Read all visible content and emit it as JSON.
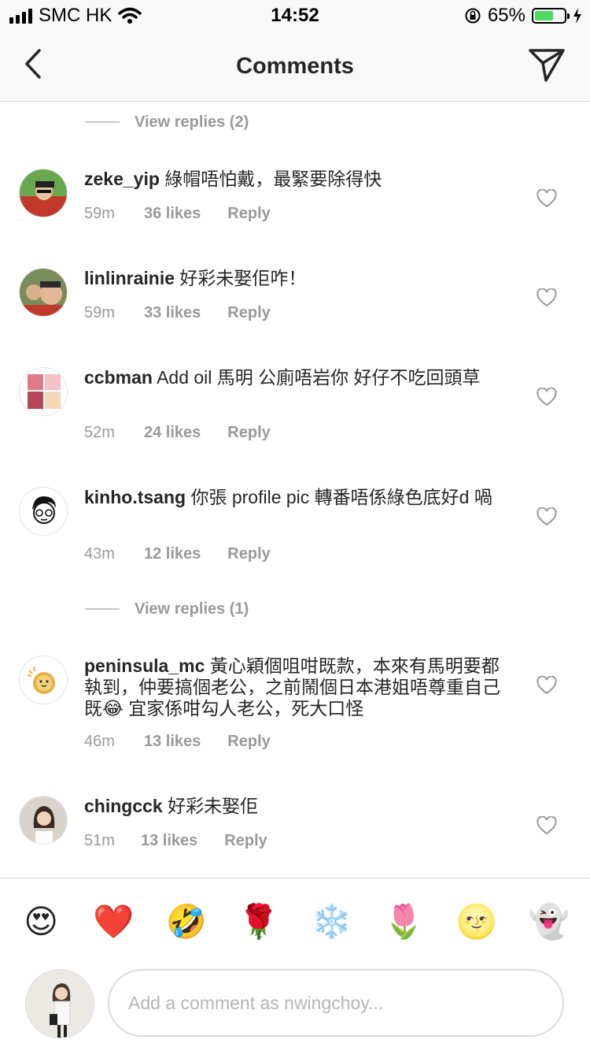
{
  "status_bar": {
    "carrier": "SMC HK",
    "time": "14:52",
    "battery": "65%",
    "battery_level": 0.65
  },
  "nav": {
    "title": "Comments",
    "back_icon": "chevron-left-icon",
    "send_icon": "paper-plane-icon"
  },
  "view_replies": [
    "View replies (2)",
    "View replies (1)"
  ],
  "comments": [
    {
      "user": "zeke_yip",
      "text": "綠帽唔怕戴，最緊要除得快",
      "time": "59m",
      "likes": "36 likes",
      "reply": "Reply"
    },
    {
      "user": "linlinrainie",
      "text": "好彩未娶佢咋！",
      "time": "59m",
      "likes": "33 likes",
      "reply": "Reply"
    },
    {
      "user": "ccbman",
      "text": "Add oil 馬明 公廁唔岩你 好仔不吃回頭草",
      "time": "52m",
      "likes": "24 likes",
      "reply": "Reply"
    },
    {
      "user": "kinho.tsang",
      "text": "你張 profile pic 轉番唔係綠色底好d 喎",
      "time": "43m",
      "likes": "12 likes",
      "reply": "Reply"
    },
    {
      "user": "peninsula_mc",
      "text": "黃心穎個咀咁既款，本來有馬明要都執到，仲要搞個老公，之前鬧個日本港姐唔尊重自己既😂 宜家係咁勾人老公，死大口怪",
      "time": "46m",
      "likes": "13 likes",
      "reply": "Reply"
    },
    {
      "user": "chingcck",
      "text": "好彩未娶佢",
      "time": "51m",
      "likes": "13 likes",
      "reply": "Reply"
    }
  ],
  "emoji_bar": [
    "😍",
    "❤️",
    "🤣",
    "🌹",
    "❄️",
    "🌷",
    "🌝",
    "👻"
  ],
  "comment_input": {
    "placeholder": "Add a comment as nwingchoy..."
  },
  "colors": {
    "heart_outline": "#999999",
    "meta_text": "#999999",
    "battery_green": "#4cd964"
  }
}
